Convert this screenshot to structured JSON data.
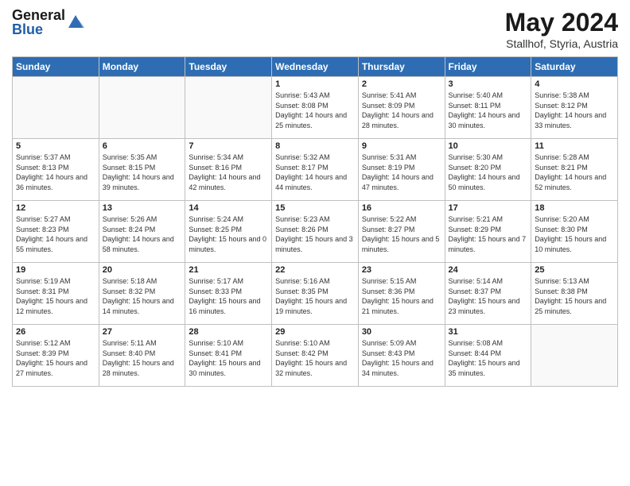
{
  "logo": {
    "general": "General",
    "blue": "Blue"
  },
  "title": {
    "month_year": "May 2024",
    "location": "Stallhof, Styria, Austria"
  },
  "days_of_week": [
    "Sunday",
    "Monday",
    "Tuesday",
    "Wednesday",
    "Thursday",
    "Friday",
    "Saturday"
  ],
  "weeks": [
    [
      {
        "day": "",
        "info": ""
      },
      {
        "day": "",
        "info": ""
      },
      {
        "day": "",
        "info": ""
      },
      {
        "day": "1",
        "info": "Sunrise: 5:43 AM\nSunset: 8:08 PM\nDaylight: 14 hours and 25 minutes."
      },
      {
        "day": "2",
        "info": "Sunrise: 5:41 AM\nSunset: 8:09 PM\nDaylight: 14 hours and 28 minutes."
      },
      {
        "day": "3",
        "info": "Sunrise: 5:40 AM\nSunset: 8:11 PM\nDaylight: 14 hours and 30 minutes."
      },
      {
        "day": "4",
        "info": "Sunrise: 5:38 AM\nSunset: 8:12 PM\nDaylight: 14 hours and 33 minutes."
      }
    ],
    [
      {
        "day": "5",
        "info": "Sunrise: 5:37 AM\nSunset: 8:13 PM\nDaylight: 14 hours and 36 minutes."
      },
      {
        "day": "6",
        "info": "Sunrise: 5:35 AM\nSunset: 8:15 PM\nDaylight: 14 hours and 39 minutes."
      },
      {
        "day": "7",
        "info": "Sunrise: 5:34 AM\nSunset: 8:16 PM\nDaylight: 14 hours and 42 minutes."
      },
      {
        "day": "8",
        "info": "Sunrise: 5:32 AM\nSunset: 8:17 PM\nDaylight: 14 hours and 44 minutes."
      },
      {
        "day": "9",
        "info": "Sunrise: 5:31 AM\nSunset: 8:19 PM\nDaylight: 14 hours and 47 minutes."
      },
      {
        "day": "10",
        "info": "Sunrise: 5:30 AM\nSunset: 8:20 PM\nDaylight: 14 hours and 50 minutes."
      },
      {
        "day": "11",
        "info": "Sunrise: 5:28 AM\nSunset: 8:21 PM\nDaylight: 14 hours and 52 minutes."
      }
    ],
    [
      {
        "day": "12",
        "info": "Sunrise: 5:27 AM\nSunset: 8:23 PM\nDaylight: 14 hours and 55 minutes."
      },
      {
        "day": "13",
        "info": "Sunrise: 5:26 AM\nSunset: 8:24 PM\nDaylight: 14 hours and 58 minutes."
      },
      {
        "day": "14",
        "info": "Sunrise: 5:24 AM\nSunset: 8:25 PM\nDaylight: 15 hours and 0 minutes."
      },
      {
        "day": "15",
        "info": "Sunrise: 5:23 AM\nSunset: 8:26 PM\nDaylight: 15 hours and 3 minutes."
      },
      {
        "day": "16",
        "info": "Sunrise: 5:22 AM\nSunset: 8:27 PM\nDaylight: 15 hours and 5 minutes."
      },
      {
        "day": "17",
        "info": "Sunrise: 5:21 AM\nSunset: 8:29 PM\nDaylight: 15 hours and 7 minutes."
      },
      {
        "day": "18",
        "info": "Sunrise: 5:20 AM\nSunset: 8:30 PM\nDaylight: 15 hours and 10 minutes."
      }
    ],
    [
      {
        "day": "19",
        "info": "Sunrise: 5:19 AM\nSunset: 8:31 PM\nDaylight: 15 hours and 12 minutes."
      },
      {
        "day": "20",
        "info": "Sunrise: 5:18 AM\nSunset: 8:32 PM\nDaylight: 15 hours and 14 minutes."
      },
      {
        "day": "21",
        "info": "Sunrise: 5:17 AM\nSunset: 8:33 PM\nDaylight: 15 hours and 16 minutes."
      },
      {
        "day": "22",
        "info": "Sunrise: 5:16 AM\nSunset: 8:35 PM\nDaylight: 15 hours and 19 minutes."
      },
      {
        "day": "23",
        "info": "Sunrise: 5:15 AM\nSunset: 8:36 PM\nDaylight: 15 hours and 21 minutes."
      },
      {
        "day": "24",
        "info": "Sunrise: 5:14 AM\nSunset: 8:37 PM\nDaylight: 15 hours and 23 minutes."
      },
      {
        "day": "25",
        "info": "Sunrise: 5:13 AM\nSunset: 8:38 PM\nDaylight: 15 hours and 25 minutes."
      }
    ],
    [
      {
        "day": "26",
        "info": "Sunrise: 5:12 AM\nSunset: 8:39 PM\nDaylight: 15 hours and 27 minutes."
      },
      {
        "day": "27",
        "info": "Sunrise: 5:11 AM\nSunset: 8:40 PM\nDaylight: 15 hours and 28 minutes."
      },
      {
        "day": "28",
        "info": "Sunrise: 5:10 AM\nSunset: 8:41 PM\nDaylight: 15 hours and 30 minutes."
      },
      {
        "day": "29",
        "info": "Sunrise: 5:10 AM\nSunset: 8:42 PM\nDaylight: 15 hours and 32 minutes."
      },
      {
        "day": "30",
        "info": "Sunrise: 5:09 AM\nSunset: 8:43 PM\nDaylight: 15 hours and 34 minutes."
      },
      {
        "day": "31",
        "info": "Sunrise: 5:08 AM\nSunset: 8:44 PM\nDaylight: 15 hours and 35 minutes."
      },
      {
        "day": "",
        "info": ""
      }
    ]
  ]
}
